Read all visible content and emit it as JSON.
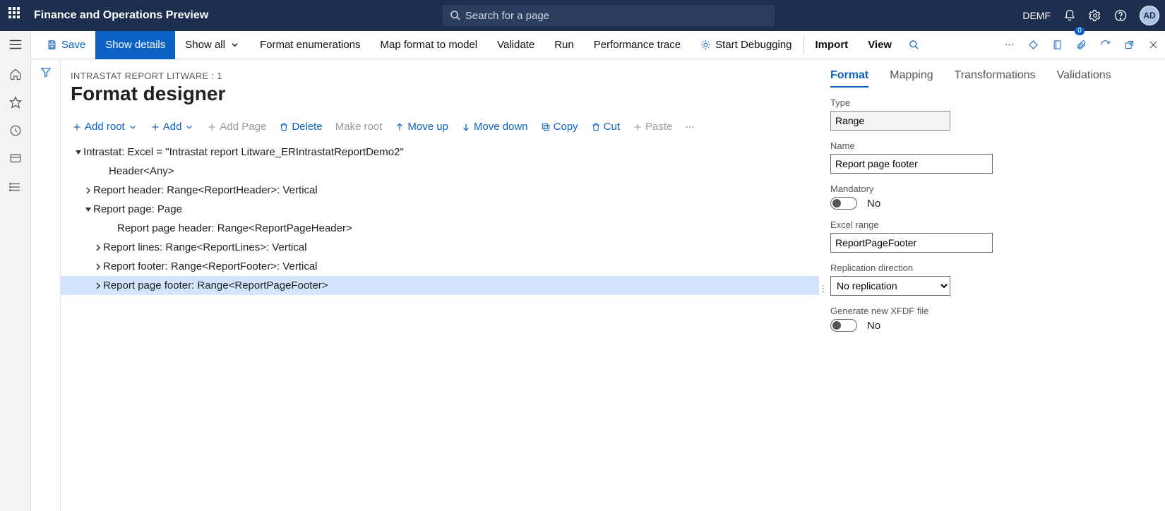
{
  "titlebar": {
    "app_title": "Finance and Operations Preview",
    "search_placeholder": "Search for a page",
    "company": "DEMF",
    "avatar": "AD"
  },
  "cmdbar": {
    "save": "Save",
    "show_details": "Show details",
    "show_all": "Show all",
    "format_enums": "Format enumerations",
    "map_format": "Map format to model",
    "validate": "Validate",
    "run": "Run",
    "perf_trace": "Performance trace",
    "start_debug": "Start Debugging",
    "import": "Import",
    "view": "View",
    "badge_count": "0"
  },
  "page": {
    "breadcrumb": "INTRASTAT REPORT LITWARE : 1",
    "title": "Format designer"
  },
  "actions": {
    "add_root": "Add root",
    "add": "Add",
    "add_page": "Add Page",
    "delete": "Delete",
    "make_root": "Make root",
    "move_up": "Move up",
    "move_down": "Move down",
    "copy": "Copy",
    "cut": "Cut",
    "paste": "Paste"
  },
  "tree": {
    "n0": "Intrastat: Excel = \"Intrastat report Litware_ERIntrastatReportDemo2\"",
    "n1": "Header<Any>",
    "n2": "Report header: Range<ReportHeader>: Vertical",
    "n3": "Report page: Page",
    "n4": "Report page header: Range<ReportPageHeader>",
    "n5": "Report lines: Range<ReportLines>: Vertical",
    "n6": "Report footer: Range<ReportFooter>: Vertical",
    "n7": "Report page footer: Range<ReportPageFooter>"
  },
  "tabs": {
    "format": "Format",
    "mapping": "Mapping",
    "transformations": "Transformations",
    "validations": "Validations"
  },
  "props": {
    "type_label": "Type",
    "type_value": "Range",
    "name_label": "Name",
    "name_value": "Report page footer",
    "mandatory_label": "Mandatory",
    "mandatory_value": "No",
    "excel_range_label": "Excel range",
    "excel_range_value": "ReportPageFooter",
    "replication_label": "Replication direction",
    "replication_value": "No replication",
    "xfdf_label": "Generate new XFDF file",
    "xfdf_value": "No"
  }
}
